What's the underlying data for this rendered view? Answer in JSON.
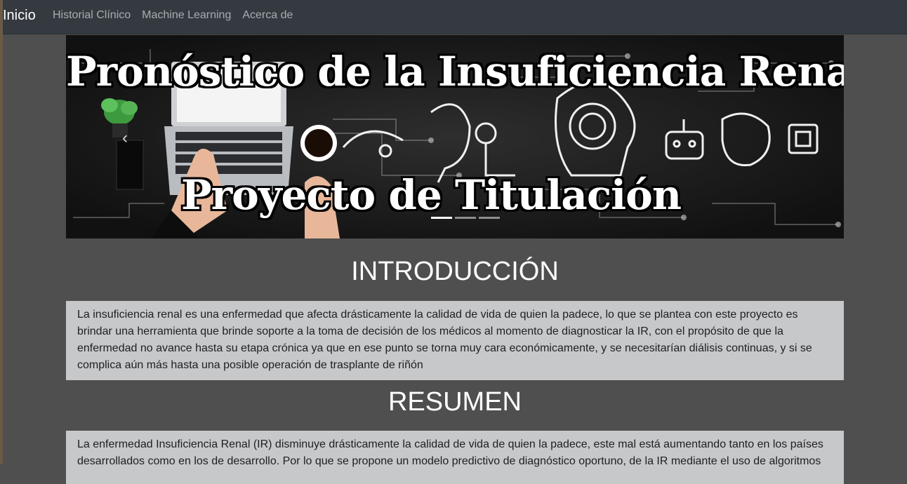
{
  "nav": {
    "brand": "Inicio",
    "links": [
      "Historial Clínico",
      "Machine Learning",
      "Acerca de"
    ]
  },
  "carousel": {
    "title_line1": "Pronóstico de la Insuficiencia Renal",
    "title_line2": "Proyecto de Titulación",
    "prev_icon": "chevron-left-icon",
    "prev_glyph": "‹",
    "slide_count": 3,
    "active_slide": 1
  },
  "introduction": {
    "heading": "INTRODUCCIÓN",
    "body": "La insuficiencia renal es una enfermedad que afecta drásticamente la calidad de vida de quien la padece, lo que se plantea con este proyecto es brindar una herramienta que brinde soporte a la toma de decisión de los médicos al momento de diagnosticar la IR, con el propósito de que la enfermedad no avance hasta su etapa crónica ya que en ese punto se torna muy cara económicamente, y se necesitarían diálisis continuas, y si se complica aún más hasta una posible operación de trasplante de riñón"
  },
  "summary": {
    "heading": "RESUMEN",
    "body": "La enfermedad Insuficiencia Renal (IR) disminuye drásticamente la calidad de vida de quien la padece, este mal está aumentando tanto en los países desarrollados como en los de desarrollo. Por lo que se propone un modelo predictivo de diagnóstico oportuno, de la IR mediante el uso de algoritmos"
  },
  "colors": {
    "page_bg": "#4f4f4f",
    "navbar_bg": "#343a40",
    "card_bg": "#c7c8ca"
  }
}
